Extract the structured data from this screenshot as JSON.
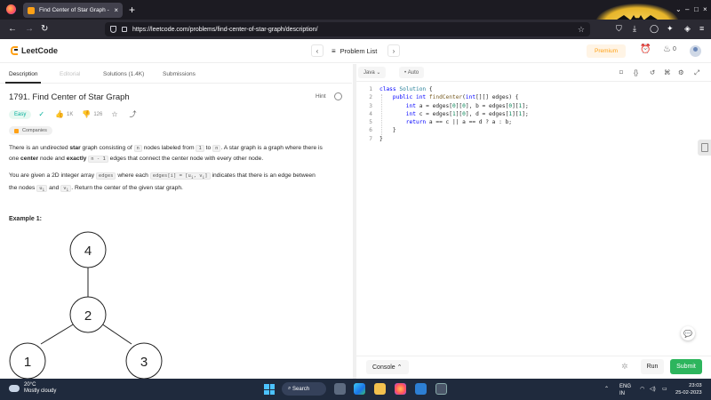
{
  "browser": {
    "tab_title": "Find Center of Star Graph - Lee",
    "tab_close": "×",
    "new_tab": "+",
    "url": "https://leetcode.com/problems/find-center-of-star-graph/description/",
    "window_controls": [
      "⌄",
      "–",
      "□",
      "×"
    ]
  },
  "header": {
    "logo": "LeetCode",
    "problem_list": "Problem List",
    "premium": "Premium",
    "streak": "0"
  },
  "left_tabs": [
    "Description",
    "Editorial",
    "Solutions (1.4K)",
    "Submissions"
  ],
  "problem": {
    "title": "1791. Find Center of Star Graph",
    "hint": "Hint",
    "difficulty": "Easy",
    "likes": "1K",
    "dislikes": "126",
    "companies": "Companies",
    "p1": {
      "a": "There is an undirected ",
      "b": "star",
      "c": " graph consisting of ",
      "d": "n",
      "e": " nodes labeled from ",
      "f": "1",
      "g": " to ",
      "h": "n",
      "i": ". A star graph is a graph where there is",
      "j": "one ",
      "k": "center",
      "l": " node and ",
      "m": "exactly",
      "n": "n - 1",
      "o": " edges that connect the center node with every other node."
    },
    "p2": {
      "a": "You are given a 2D integer array ",
      "b": "edges",
      "c": " where each ",
      "d": "edges[i] = [u",
      "d_sub": "i",
      "d2": ", v",
      "d2_sub": "i",
      "d3": "]",
      "e": " indicates that there is an edge between",
      "f": "the nodes ",
      "g": "u",
      "g_sub": "i",
      "h": " and ",
      "i": "v",
      "i_sub": "i",
      "j": ". Return the center of the given star graph."
    },
    "example_label": "Example 1:",
    "graph_nodes": [
      "4",
      "2",
      "1",
      "3"
    ]
  },
  "editor": {
    "language": "Java",
    "auto": "Auto",
    "code_lines": [
      {
        "n": "1"
      },
      {
        "n": "2"
      },
      {
        "n": "3"
      },
      {
        "n": "4"
      },
      {
        "n": "5"
      },
      {
        "n": "6"
      },
      {
        "n": "7"
      }
    ],
    "code": {
      "l1a": "class ",
      "l1b": "Solution",
      "l1c": " {",
      "l2a": "    public ",
      "l2b": "int ",
      "l2c": "findCenter",
      "l2d": "(",
      "l2e": "int",
      "l2f": "[][] edges) {",
      "l3a": "        int ",
      "l3b": "a = edges[",
      "l3c": "0",
      "l3d": "][",
      "l3e": "0",
      "l3f": "], b = edges[",
      "l3g": "0",
      "l3h": "][",
      "l3i": "1",
      "l3j": "];",
      "l4a": "        int ",
      "l4b": "c = edges[",
      "l4c": "1",
      "l4d": "][",
      "l4e": "0",
      "l4f": "], d = edges[",
      "l4g": "1",
      "l4h": "][",
      "l4i": "1",
      "l4j": "];",
      "l5a": "        return ",
      "l5b": "a == c || a == d ? a : b;",
      "l6": "    }",
      "l7": "}"
    },
    "console": "Console",
    "run": "Run",
    "submit": "Submit"
  },
  "taskbar": {
    "temp": "20°C",
    "weather": "Mostly cloudy",
    "search": "Search",
    "lang1": "ENG",
    "lang2": "IN",
    "time": "23:03",
    "date": "25-02-2023"
  }
}
